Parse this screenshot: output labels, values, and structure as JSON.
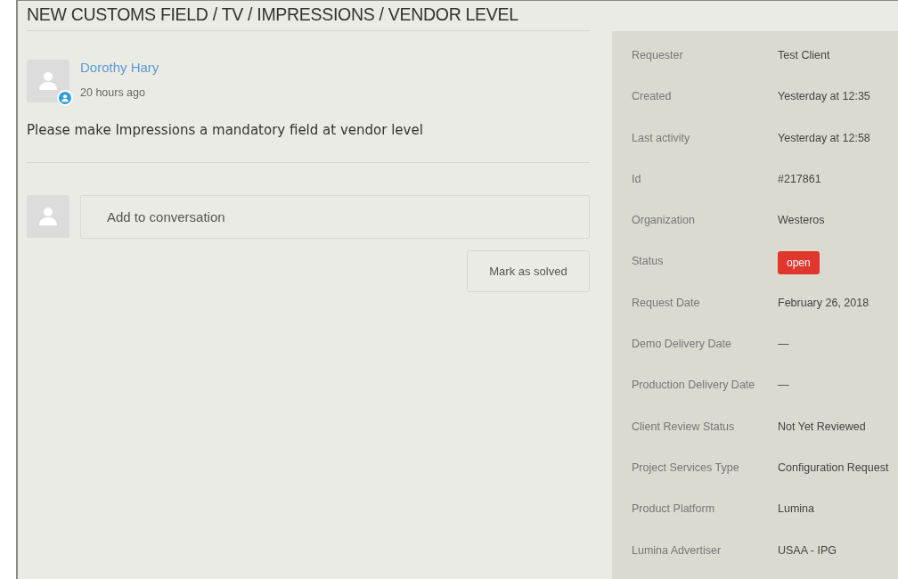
{
  "title": "NEW CUSTOMS FIELD / TV / IMPRESSIONS / VENDOR LEVEL",
  "comment": {
    "author": "Dorothy Hary",
    "time": "20 hours ago",
    "body": "Please make Impressions a mandatory field at vendor level"
  },
  "reply": {
    "placeholder": "Add to conversation"
  },
  "buttons": [
    "Mark as solved"
  ],
  "details": [
    {
      "label": "Requester",
      "value": "Test Client",
      "kind": "text"
    },
    {
      "label": "Created",
      "value": "Yesterday at 12:35",
      "kind": "text"
    },
    {
      "label": "Last activity",
      "value": "Yesterday at 12:58",
      "kind": "text"
    },
    {
      "label": "Id",
      "value": "#217861",
      "kind": "text"
    },
    {
      "label": "Organization",
      "value": "Westeros",
      "kind": "text"
    },
    {
      "label": "Status",
      "value": "open",
      "kind": "badge",
      "color": "#e0372d"
    },
    {
      "label": "Request Date",
      "value": "February 26, 2018",
      "kind": "text"
    },
    {
      "label": "Demo Delivery Date",
      "value": "—",
      "kind": "text"
    },
    {
      "label": "Production Delivery Date",
      "value": "—",
      "kind": "text"
    },
    {
      "label": "Client Review Status",
      "value": "Not Yet Reviewed",
      "kind": "text"
    },
    {
      "label": "Project Services Type",
      "value": "Configuration Request",
      "kind": "text"
    },
    {
      "label": "Product Platform",
      "value": "Lumina",
      "kind": "text"
    },
    {
      "label": "Lumina Advertiser",
      "value": "USAA - IPG",
      "kind": "text"
    }
  ]
}
